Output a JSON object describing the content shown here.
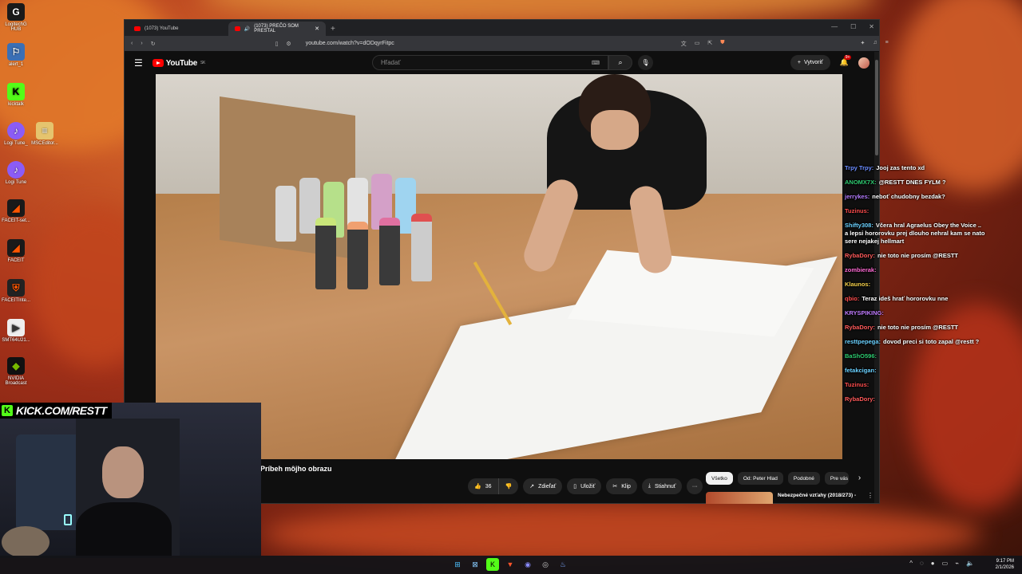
{
  "desktop": {
    "icons": [
      {
        "label": "LogitechG HUB",
        "icon": "logitech-icon",
        "color": "#1a1a1a"
      },
      {
        "label": "alert_1",
        "icon": "alert-icon",
        "color": "#3b6fb5"
      },
      {
        "label": "kicktalk",
        "icon": "kick-icon",
        "color": "#53fc18"
      },
      {
        "label": "Logi Tune_",
        "icon": "logitune-icon",
        "color": "#8b5cf6"
      },
      {
        "label": "MSCEditor...",
        "icon": "mscedit-icon",
        "color": "#e5c46e"
      },
      {
        "label": "Logi Tune",
        "icon": "logitune-icon",
        "color": "#8b5cf6"
      },
      {
        "label": "FACEIT-set...",
        "icon": "faceit-icon",
        "color": "#ff5500"
      },
      {
        "label": "FACEIT",
        "icon": "faceit-icon",
        "color": "#ff5500"
      },
      {
        "label": "FACEITInte...",
        "icon": "faceit-ac-icon",
        "color": "#222"
      },
      {
        "label": "SMT64U21...",
        "icon": "smt-icon",
        "color": "#eee"
      },
      {
        "label": "NVIDIA Broadcast",
        "icon": "nvidia-icon",
        "color": "#76b900"
      }
    ]
  },
  "browser": {
    "tabs": [
      {
        "label": "(1073) YouTube",
        "active": false
      },
      {
        "label": "(1073) PREČO SOM PRESTAL",
        "active": true
      }
    ],
    "url": "youtube.com/watch?v=dODqyrFitpc"
  },
  "youtube": {
    "logo": "YouTube",
    "region": "SK",
    "search_placeholder": "Hľadať",
    "create_label": "Vytvoriť",
    "notifications": "9+",
    "video_title": "Príbeh môjho obrazu",
    "like_count": "36",
    "share_label": "Zdieľať",
    "save_label": "Uložiť",
    "clip_label": "Klip",
    "download_label": "Stiahnuť",
    "chips": [
      "Všetko",
      "Od: Peter Hlad",
      "Podobné",
      "Pre vás"
    ],
    "rec_title": "Nebezpečné vzťahy (2018/273) - Rohatá mrcha"
  },
  "chat": [
    {
      "user": "Trpy Trpy:",
      "color": "#6b8cff",
      "msg": "Jooj zas tento xd"
    },
    {
      "user": "ANOMX7X:",
      "color": "#2ecc71",
      "msg": "@RESTT DNES FYLM ?"
    },
    {
      "user": "jerrykes:",
      "color": "#b47cff",
      "msg": "neboť chudobny bezdak?"
    },
    {
      "user": "Tuzinus:",
      "color": "#ff4d4d",
      "msg": ""
    },
    {
      "user": "Shifty308:",
      "color": "#6ad1ff",
      "msg": "Včera hral Agraelus Obey the Voice .. a lepsi hororovku prej dlouho nehral kam se nato sere nejakej hellmart"
    },
    {
      "user": "RybaDory:",
      "color": "#ff5a5a",
      "msg": "nie toto nie prosím @RESTT"
    },
    {
      "user": "zombierak:",
      "color": "#ff6ad5",
      "msg": ""
    },
    {
      "user": "Klaunos:",
      "color": "#f5d04a",
      "msg": ""
    },
    {
      "user": "qbio:",
      "color": "#ff4d4d",
      "msg": "Teraz ideš hrať hororovku nne"
    },
    {
      "user": "KRYSPIKING:",
      "color": "#c07cff",
      "msg": ""
    },
    {
      "user": "RybaDory:",
      "color": "#ff5a5a",
      "msg": "nie toto nie prosím @RESTT"
    },
    {
      "user": "resttpepega:",
      "color": "#6ad1ff",
      "msg": "dovod preci si toto zapal @restt ?"
    },
    {
      "user": "BaShO596:",
      "color": "#2ecc71",
      "msg": ""
    },
    {
      "user": "fetakcigan:",
      "color": "#6ad1ff",
      "msg": ""
    },
    {
      "user": "Tuzinus:",
      "color": "#ff4d4d",
      "msg": ""
    },
    {
      "user": "RybaDory:",
      "color": "#ff5a5a",
      "msg": ""
    }
  ],
  "stream": {
    "kick_url": "KICK.COM/RESTT"
  },
  "taskbar": {
    "time": "9:17 PM",
    "date": "2/1/2026"
  }
}
